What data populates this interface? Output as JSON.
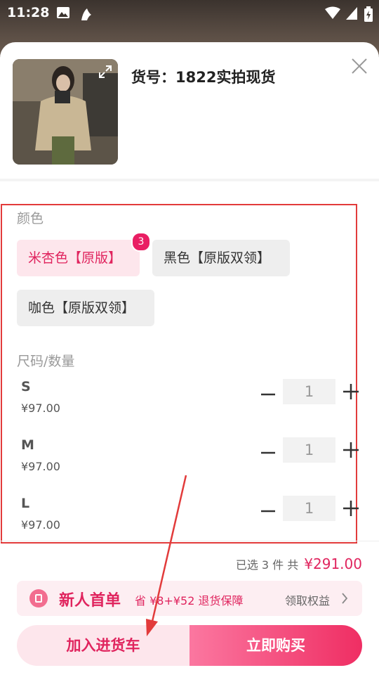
{
  "status": {
    "time": "11:28"
  },
  "product": {
    "title": "货号：1822实拍现货"
  },
  "color": {
    "label": "颜色",
    "options": [
      {
        "label": "米杏色【原版】",
        "count": "3",
        "selected": true
      },
      {
        "label": "黑色【原版双领】",
        "selected": false
      },
      {
        "label": "咖色【原版双领】",
        "selected": false
      }
    ]
  },
  "size": {
    "label": "尺码/数量",
    "rows": [
      {
        "name": "S",
        "price": "¥97.00",
        "qty": "1"
      },
      {
        "name": "M",
        "price": "¥97.00",
        "qty": "1"
      },
      {
        "name": "L",
        "price": "¥97.00",
        "qty": "1"
      }
    ]
  },
  "summary": {
    "selected_text": "已选 3 件 共",
    "total": "¥291.00"
  },
  "promo": {
    "title": "新人首单",
    "desc": "省 ¥8+¥52 退货保障",
    "link": "领取权益"
  },
  "actions": {
    "cart": "加入进货车",
    "buy": "立即购买"
  },
  "colors": {
    "accent": "#e0245e",
    "annotation": "#e23b3b"
  }
}
